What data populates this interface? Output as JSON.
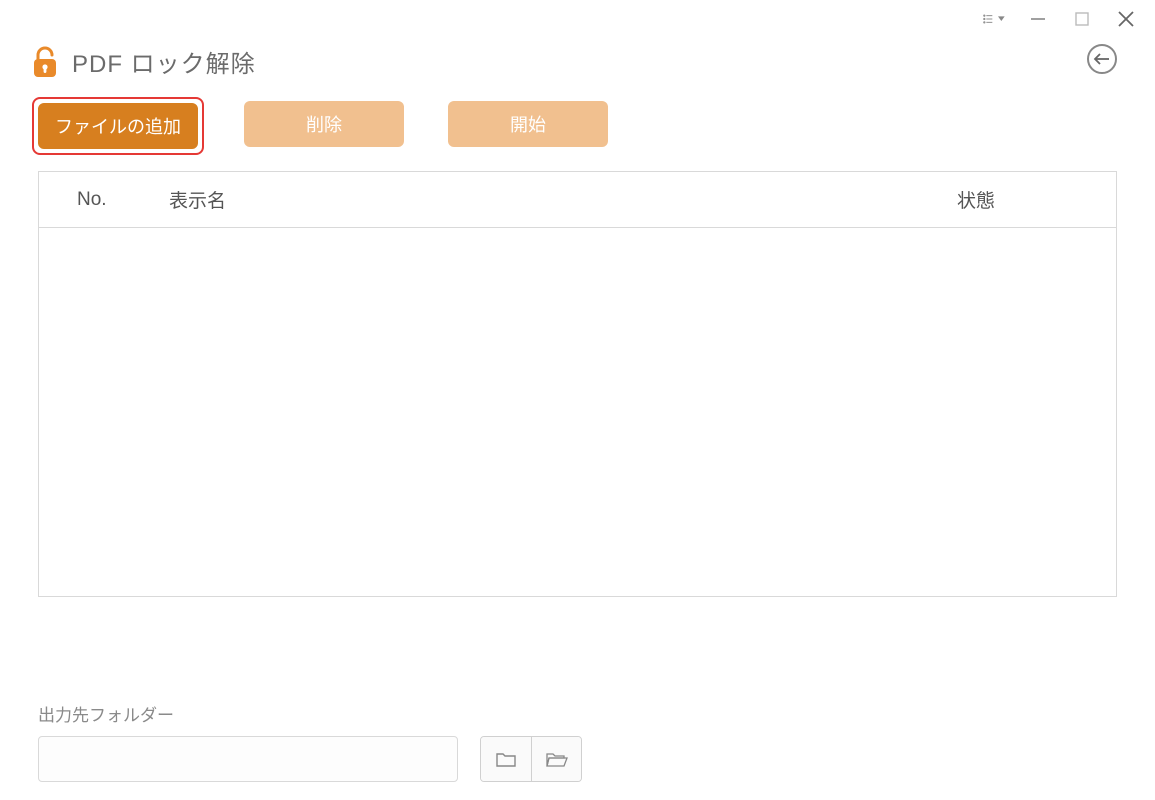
{
  "window": {
    "title": "PDF ロック解除"
  },
  "toolbar": {
    "add_label": "ファイルの追加",
    "delete_label": "削除",
    "start_label": "開始"
  },
  "table": {
    "headers": {
      "no": "No.",
      "name": "表示名",
      "status": "状態"
    },
    "rows": []
  },
  "output": {
    "label": "出力先フォルダー",
    "path": ""
  },
  "icons": {
    "lock": "lock-icon",
    "back": "back-arrow-icon",
    "menu": "menu-dropdown-icon",
    "minimize": "minimize-icon",
    "maximize": "maximize-icon",
    "close": "close-icon",
    "folder": "folder-icon",
    "folder_open": "folder-open-icon"
  },
  "colors": {
    "accent": "#d77f1f",
    "accent_light": "#f1c08f",
    "highlight": "#e53935"
  }
}
